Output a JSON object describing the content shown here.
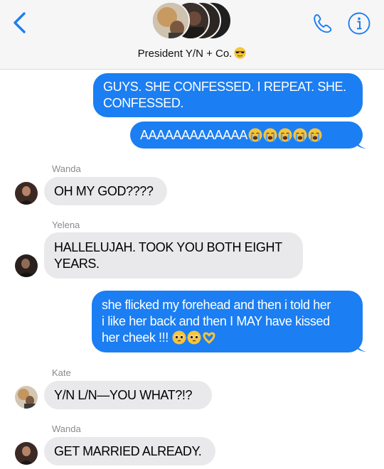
{
  "header": {
    "title": "President Y/N + Co.",
    "title_emoji": "sunglasses-face-emoji"
  },
  "messages": [
    {
      "dir": "out",
      "text": "GUYS. SHE CONFESSED. I REPEAT. SHE.\nCONFESSED."
    },
    {
      "dir": "out",
      "text": "AAAAAAAAAAAAA",
      "emojis": [
        "loudly-crying-face",
        "loudly-crying-face",
        "loudly-crying-face",
        "loudly-crying-face",
        "loudly-crying-face"
      ]
    },
    {
      "dir": "in",
      "sender": "Wanda",
      "text": "OH MY GOD????"
    },
    {
      "dir": "in",
      "sender": "Yelena",
      "text": "HALLELUJAH. TOOK YOU BOTH EIGHT\nYEARS."
    },
    {
      "dir": "out",
      "text": "she flicked my forehead and then i told her\ni like her back and then I MAY have kissed\nher cheek !!!",
      "emojis": [
        "pleading-face",
        "pleading-face",
        "heart-hands"
      ]
    },
    {
      "dir": "in",
      "sender": "Kate",
      "text": "Y/N L/N—YOU WHAT?!?"
    },
    {
      "dir": "in",
      "sender": "Wanda",
      "text": "GET MARRIED ALREADY."
    }
  ],
  "colors": {
    "outgoing_bubble": "#1b7ef2",
    "incoming_bubble": "#e9e9eb",
    "accent": "#1b7ef2",
    "sender_label": "#8a8a8e"
  }
}
